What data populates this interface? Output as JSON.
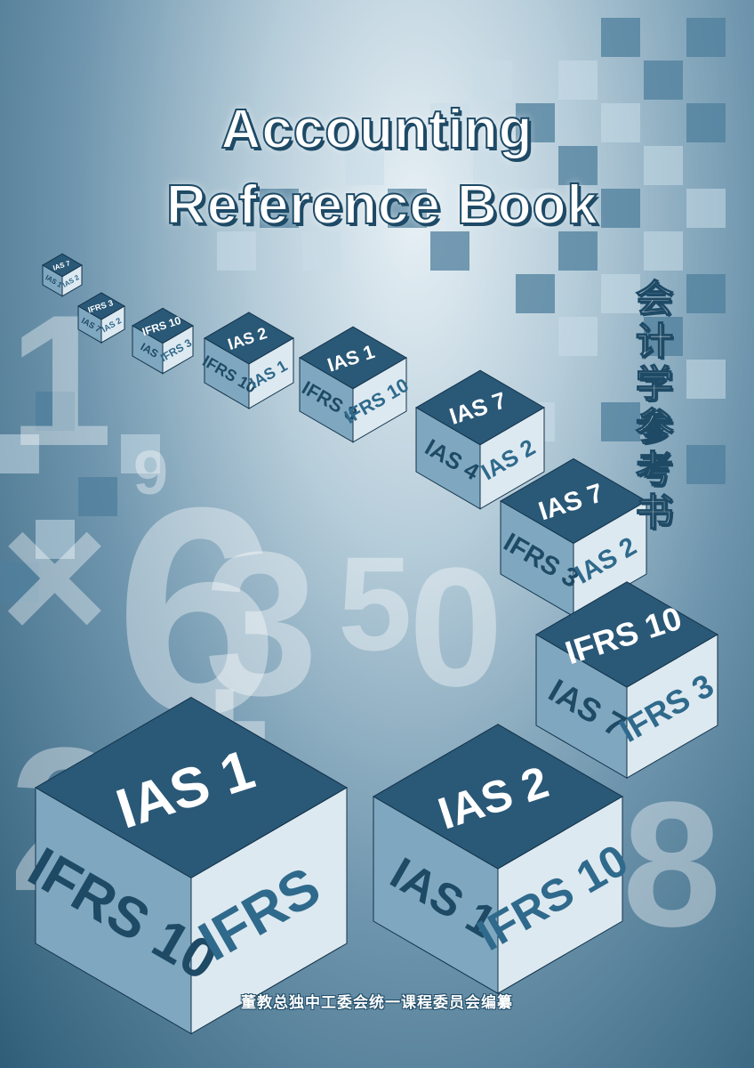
{
  "cover": {
    "title_line1": "Accounting",
    "title_line2": "Reference Book",
    "title_cn": [
      "会",
      "计",
      "学",
      "参",
      "考",
      "书"
    ],
    "publisher": "董教总独中工委会统一课程委员会编纂"
  },
  "palette": {
    "dark": "#1e4a66",
    "mid": "#4f7f9c",
    "light": "#c9dde8"
  },
  "digits": [
    "1",
    "9",
    "6",
    "3",
    "5",
    "0",
    "2",
    "8",
    "×",
    "+"
  ],
  "cube_labels": [
    [
      "IAS 7",
      "IAS 1",
      "IAS 2"
    ],
    [
      "IFRS 3",
      "IAS 7",
      "IAS 2"
    ],
    [
      "IFRS 10",
      "IAS",
      "IFRS 3"
    ],
    [
      "IAS 2",
      "IFRS 10",
      "IAS 1"
    ],
    [
      "IAS 1",
      "IFRS 3",
      "IFRS 10"
    ],
    [
      "IAS 7",
      "IAS 4",
      "IAS 2"
    ],
    [
      "IAS 7",
      "IFRS 3",
      "IAS 2"
    ],
    [
      "IFRS 10",
      "IAS 7",
      "IFRS 3"
    ],
    [
      "IAS 1",
      "IFRS 10",
      "IFRS"
    ],
    [
      "IAS 2",
      "IAS 1",
      "IFRS 10"
    ]
  ]
}
